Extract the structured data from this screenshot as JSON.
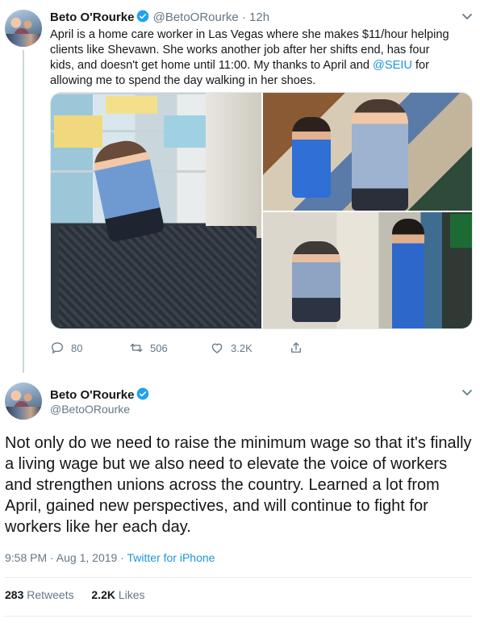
{
  "tweet1": {
    "author": {
      "name": "Beto O'Rourke",
      "handle": "@BetoORourke",
      "time": "12h"
    },
    "text_part1": "April is a home care worker in Las Vegas where she makes $11/hour helping clients like Shevawn. She works another job after her shifts end, has four kids, and doesn't get home until 11:00. My thanks to April and ",
    "mention": "@SEIU",
    "text_part2": " for allowing me to spend the day walking in her shoes.",
    "actions": {
      "replies": "80",
      "retweets": "506",
      "likes": "3.2K"
    }
  },
  "tweet2": {
    "author": {
      "name": "Beto O'Rourke",
      "handle": "@BetoORourke"
    },
    "text": "Not only do we need to raise the minimum wage so that it's finally a living wage but we also need to elevate the voice of workers and strengthen unions across the country. Learned a lot from April, gained new perspectives, and will continue to fight for workers like her each day.",
    "timestamp": "9:58 PM · Aug 1, 2019 · ",
    "source": "Twitter for iPhone",
    "retweets_count": "283",
    "retweets_label": "Retweets",
    "likes_count": "2.2K",
    "likes_label": "Likes"
  },
  "colors": {
    "accent": "#1b95e0",
    "muted": "#657786",
    "text": "#14171a",
    "divider": "#e6ecf0"
  },
  "icons": [
    "verified-badge-icon",
    "chevron-down-icon",
    "reply-icon",
    "retweet-icon",
    "like-icon",
    "share-icon"
  ]
}
